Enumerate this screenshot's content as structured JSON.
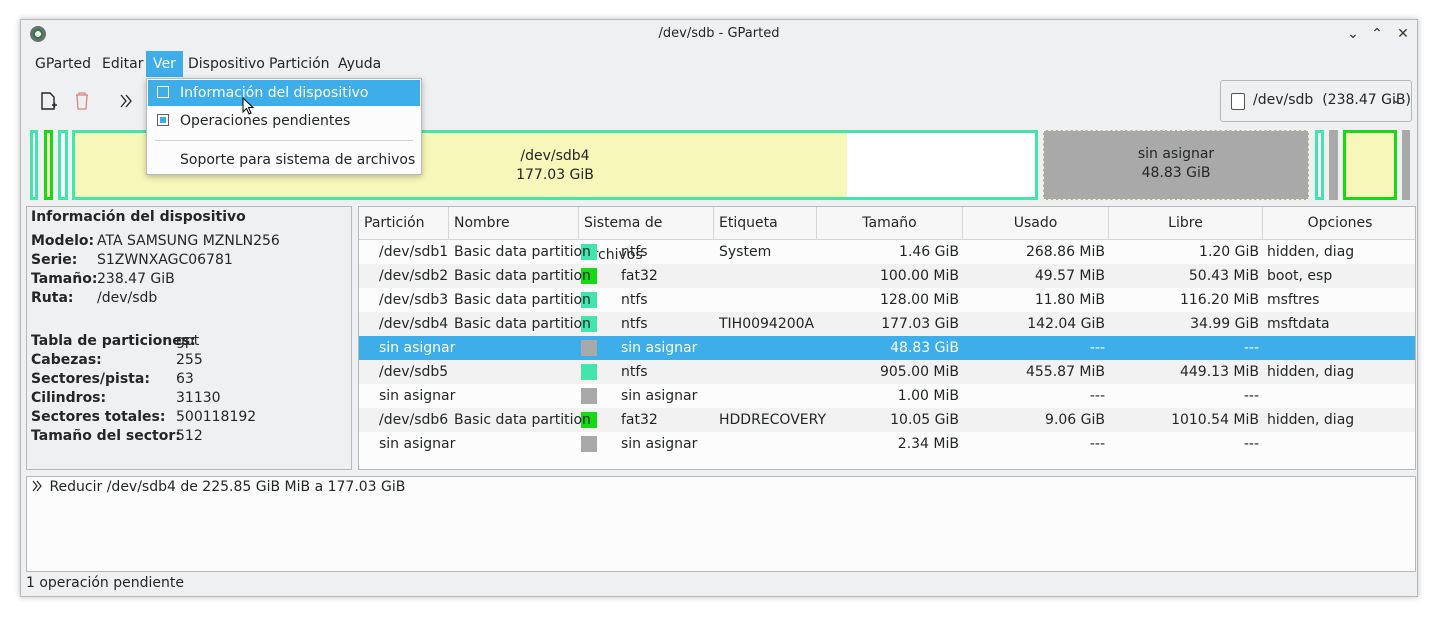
{
  "window": {
    "title": "/dev/sdb - GParted"
  },
  "menu": [
    "GParted",
    "Editar",
    "Ver",
    "Dispositivo",
    "Partición",
    "Ayuda"
  ],
  "ver_menu": {
    "items": [
      {
        "label": "Información del dispositivo",
        "checked": false,
        "highlighted": true
      },
      {
        "label": "Operaciones pendientes",
        "checked": true,
        "highlighted": false
      },
      {
        "label": "Soporte para sistema de archivos"
      }
    ]
  },
  "device_selector": {
    "device": "/dev/sdb",
    "size": "(238.47 GiB)"
  },
  "partition_map": [
    {
      "name": "/dev/sdb4",
      "size": "177.03 GiB"
    },
    {
      "name": "sin asignar",
      "size": "48.83 GiB"
    }
  ],
  "device_info": {
    "title": "Información del dispositivo",
    "group1": [
      {
        "key": "Modelo:",
        "value": "ATA SAMSUNG MZNLN256"
      },
      {
        "key": "Serie:",
        "value": "S1ZWNXAGC06781"
      },
      {
        "key": "Tamaño:",
        "value": "238.47 GiB"
      },
      {
        "key": "Ruta:",
        "value": "/dev/sdb"
      }
    ],
    "group2": [
      {
        "key": "Tabla de particiones:",
        "value": "gpt"
      },
      {
        "key": "Cabezas:",
        "value": "255"
      },
      {
        "key": "Sectores/pista:",
        "value": "63"
      },
      {
        "key": "Cilindros:",
        "value": "31130"
      },
      {
        "key": "Sectores totales:",
        "value": "500118192"
      },
      {
        "key": "Tamaño del sector:",
        "value": "512"
      }
    ]
  },
  "table": {
    "headers": [
      "Partición",
      "Nombre",
      "Sistema de archivos",
      "Etiqueta",
      "Tamaño",
      "Usado",
      "Libre",
      "Opciones"
    ],
    "rows": [
      {
        "particion": "/dev/sdb1",
        "nombre": "Basic data partition",
        "fs": "ntfs",
        "fs_color": "#42e5ac",
        "etiqueta": "System",
        "tamano": "1.46 GiB",
        "usado": "268.86 MiB",
        "libre": "1.20 GiB",
        "opciones": "hidden, diag"
      },
      {
        "particion": "/dev/sdb2",
        "nombre": "Basic data partition",
        "fs": "fat32",
        "fs_color": "#18d918",
        "etiqueta": "",
        "tamano": "100.00 MiB",
        "usado": "49.57 MiB",
        "libre": "50.43 MiB",
        "opciones": "boot, esp"
      },
      {
        "particion": "/dev/sdb3",
        "nombre": "Basic data partition",
        "fs": "ntfs",
        "fs_color": "#42e5ac",
        "etiqueta": "",
        "tamano": "128.00 MiB",
        "usado": "11.80 MiB",
        "libre": "116.20 MiB",
        "opciones": "msftres"
      },
      {
        "particion": "/dev/sdb4",
        "nombre": "Basic data partition",
        "fs": "ntfs",
        "fs_color": "#42e5ac",
        "etiqueta": "TIH0094200A",
        "tamano": "177.03 GiB",
        "usado": "142.04 GiB",
        "libre": "34.99 GiB",
        "opciones": "msftdata"
      },
      {
        "particion": "sin asignar",
        "nombre": "",
        "fs": "sin asignar",
        "fs_color": "#a9a9a9",
        "etiqueta": "",
        "tamano": "48.83 GiB",
        "usado": "---",
        "libre": "---",
        "opciones": "",
        "selected": true
      },
      {
        "particion": "/dev/sdb5",
        "nombre": "",
        "fs": "ntfs",
        "fs_color": "#42e5ac",
        "etiqueta": "",
        "tamano": "905.00 MiB",
        "usado": "455.87 MiB",
        "libre": "449.13 MiB",
        "opciones": "hidden, diag"
      },
      {
        "particion": "sin asignar",
        "nombre": "",
        "fs": "sin asignar",
        "fs_color": "#a9a9a9",
        "etiqueta": "",
        "tamano": "1.00 MiB",
        "usado": "---",
        "libre": "---",
        "opciones": ""
      },
      {
        "particion": "/dev/sdb6",
        "nombre": "Basic data partition",
        "fs": "fat32",
        "fs_color": "#18d918",
        "etiqueta": "HDDRECOVERY",
        "tamano": "10.05 GiB",
        "usado": "9.06 GiB",
        "libre": "1010.54 MiB",
        "opciones": "hidden, diag"
      },
      {
        "particion": "sin asignar",
        "nombre": "",
        "fs": "sin asignar",
        "fs_color": "#a9a9a9",
        "etiqueta": "",
        "tamano": "2.34 MiB",
        "usado": "---",
        "libre": "---",
        "opciones": ""
      }
    ]
  },
  "operations": [
    "Reducir /dev/sdb4 de 225.85 GiB MiB a 177.03 GiB"
  ],
  "status": "1 operación pendiente",
  "colors": {
    "accent": "#3daee9",
    "ntfs": "#42e5ac",
    "fat32": "#18d918",
    "unallocated": "#a9a9a9",
    "used": "#f7f7b9"
  }
}
